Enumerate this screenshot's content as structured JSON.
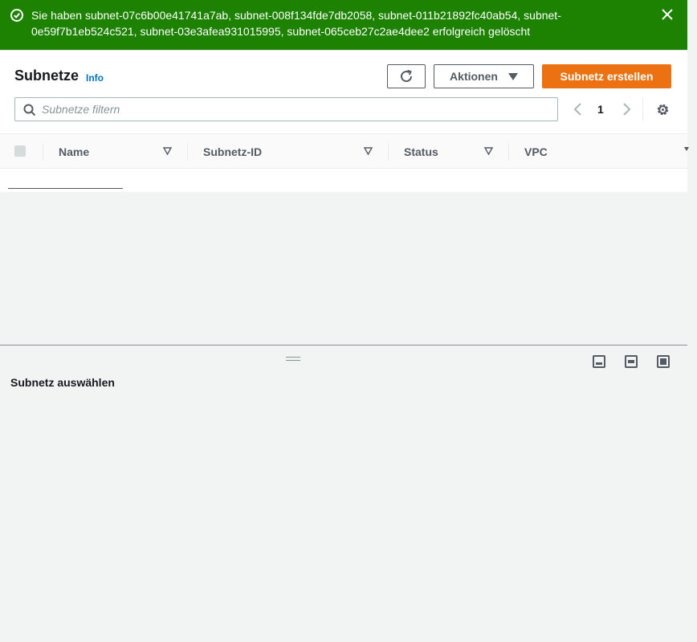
{
  "flash": {
    "message": "Sie haben subnet-07c6b00e41741a7ab, subnet-008f134fde7db2058, subnet-011b21892fc40ab54, subnet-0e59f7b1eb524c521, subnet-03e3afea931015995, subnet-065ceb27c2ae4dee2 erfolgreich gelöscht",
    "type": "success",
    "color": "#1d8102"
  },
  "header": {
    "title": "Subnetze",
    "info_label": "Info"
  },
  "toolbar": {
    "refresh_icon": "refresh-icon",
    "actions_label": "Aktionen",
    "create_label": "Subnetz erstellen",
    "create_color": "#ec7211"
  },
  "search": {
    "placeholder": "Subnetze filtern",
    "value": ""
  },
  "pagination": {
    "current_page": "1"
  },
  "table": {
    "columns": [
      {
        "label": "Name"
      },
      {
        "label": "Subnetz-ID"
      },
      {
        "label": "Status"
      },
      {
        "label": "VPC"
      }
    ],
    "rows": []
  },
  "details": {
    "placeholder": "Subnetz auswählen"
  }
}
